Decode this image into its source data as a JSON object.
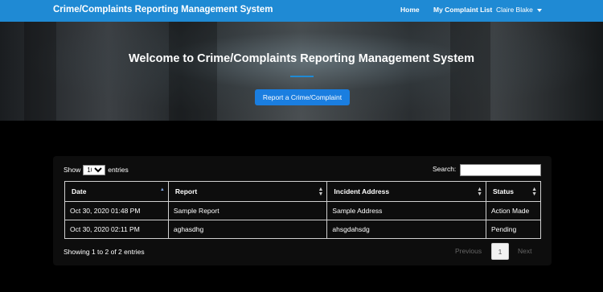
{
  "navbar": {
    "brand": "Crime/Complaints Reporting Management System",
    "home": "Home",
    "my_complaints": "My Complaint List",
    "user": "Claire Blake"
  },
  "hero": {
    "title": "Welcome to Crime/Complaints Reporting Management System",
    "button": "Report a Crime/Complaint"
  },
  "table_controls": {
    "show_label": "Show",
    "entries_value": "10",
    "entries_label": "entries",
    "search_label": "Search:",
    "search_value": ""
  },
  "table": {
    "headers": [
      "Date",
      "Report",
      "Incident Address",
      "Status"
    ],
    "rows": [
      [
        "Oct 30, 2020 01:48 PM",
        "Sample Report",
        "Sample Address",
        "Action Made"
      ],
      [
        "Oct 30, 2020 02:11 PM",
        "aghasdhg",
        "ahsgdahsdg",
        "Pending"
      ]
    ]
  },
  "footer": {
    "info": "Showing 1 to 2 of 2 entries",
    "previous": "Previous",
    "page": "1",
    "next": "Next"
  }
}
